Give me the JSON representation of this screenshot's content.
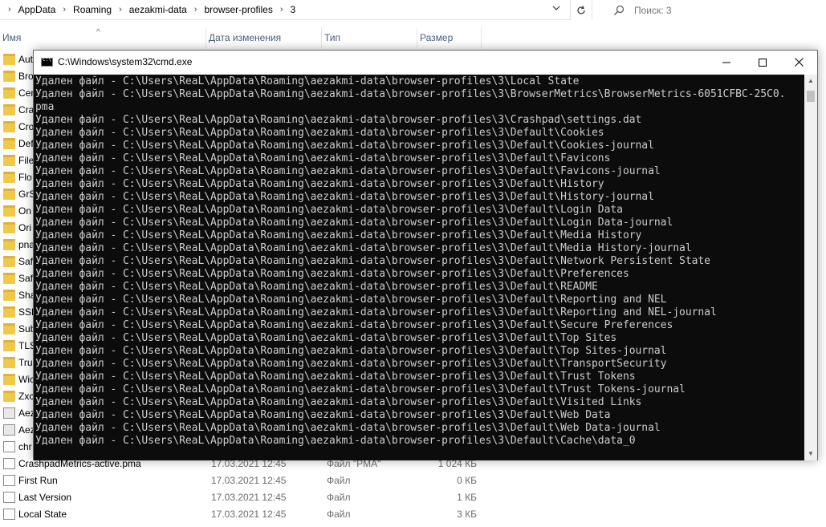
{
  "explorer": {
    "breadcrumb": [
      "AppData",
      "Roaming",
      "aezakmi-data",
      "browser-profiles",
      "3"
    ],
    "search_placeholder": "Поиск: 3",
    "columns": {
      "name": "Имя",
      "date": "Дата изменения",
      "type": "Тип",
      "size": "Размер"
    },
    "visible_rows": [
      {
        "name": "Aut",
        "icon": "folder-icon"
      },
      {
        "name": "Bro",
        "icon": "folder-icon"
      },
      {
        "name": "Cer",
        "icon": "folder-icon"
      },
      {
        "name": "Cras",
        "icon": "folder-icon"
      },
      {
        "name": "Cro",
        "icon": "folder-icon"
      },
      {
        "name": "Def",
        "icon": "folder-icon"
      },
      {
        "name": "File",
        "icon": "folder-icon"
      },
      {
        "name": "Flo",
        "icon": "folder-icon"
      },
      {
        "name": "GrS",
        "icon": "folder-icon"
      },
      {
        "name": "On",
        "icon": "folder-icon"
      },
      {
        "name": "Ori",
        "icon": "folder-icon"
      },
      {
        "name": "pna",
        "icon": "folder-icon"
      },
      {
        "name": "Saf",
        "icon": "folder-icon"
      },
      {
        "name": "Saf",
        "icon": "folder-icon"
      },
      {
        "name": "Sha",
        "icon": "folder-icon"
      },
      {
        "name": "SSL",
        "icon": "folder-icon"
      },
      {
        "name": "Sub",
        "icon": "folder-icon"
      },
      {
        "name": "TLS",
        "icon": "folder-icon"
      },
      {
        "name": "Tru",
        "icon": "folder-icon"
      },
      {
        "name": "Wic",
        "icon": "folder-icon"
      },
      {
        "name": "Zxc",
        "icon": "folder-icon"
      },
      {
        "name": "Aez",
        "icon": "app-icon"
      },
      {
        "name": "Aez",
        "icon": "app-icon"
      },
      {
        "name": "chr",
        "icon": "file-icon"
      },
      {
        "name": "CrashpadMetrics-active.pma",
        "date": "17.03.2021 12:45",
        "type": "Файл \"PMA\"",
        "size": "1 024 КБ",
        "icon": "file-icon"
      },
      {
        "name": "First Run",
        "date": "17.03.2021 12:45",
        "type": "Файл",
        "size": "0 КБ",
        "icon": "file-icon"
      },
      {
        "name": "Last Version",
        "date": "17.03.2021 12:45",
        "type": "Файл",
        "size": "1 КБ",
        "icon": "file-icon"
      },
      {
        "name": "Local State",
        "date": "17.03.2021 12:45",
        "type": "Файл",
        "size": "3 КБ",
        "icon": "file-icon"
      }
    ]
  },
  "cmd": {
    "title": "C:\\Windows\\system32\\cmd.exe",
    "lines": [
      "Удален файл - C:\\Users\\ReaL\\AppData\\Roaming\\aezakmi-data\\browser-profiles\\3\\Local State",
      "Удален файл - C:\\Users\\ReaL\\AppData\\Roaming\\aezakmi-data\\browser-profiles\\3\\BrowserMetrics\\BrowserMetrics-6051CFBC-25C0.",
      "pma",
      "Удален файл - C:\\Users\\ReaL\\AppData\\Roaming\\aezakmi-data\\browser-profiles\\3\\Crashpad\\settings.dat",
      "Удален файл - C:\\Users\\ReaL\\AppData\\Roaming\\aezakmi-data\\browser-profiles\\3\\Default\\Cookies",
      "Удален файл - C:\\Users\\ReaL\\AppData\\Roaming\\aezakmi-data\\browser-profiles\\3\\Default\\Cookies-journal",
      "Удален файл - C:\\Users\\ReaL\\AppData\\Roaming\\aezakmi-data\\browser-profiles\\3\\Default\\Favicons",
      "Удален файл - C:\\Users\\ReaL\\AppData\\Roaming\\aezakmi-data\\browser-profiles\\3\\Default\\Favicons-journal",
      "Удален файл - C:\\Users\\ReaL\\AppData\\Roaming\\aezakmi-data\\browser-profiles\\3\\Default\\History",
      "Удален файл - C:\\Users\\ReaL\\AppData\\Roaming\\aezakmi-data\\browser-profiles\\3\\Default\\History-journal",
      "Удален файл - C:\\Users\\ReaL\\AppData\\Roaming\\aezakmi-data\\browser-profiles\\3\\Default\\Login Data",
      "Удален файл - C:\\Users\\ReaL\\AppData\\Roaming\\aezakmi-data\\browser-profiles\\3\\Default\\Login Data-journal",
      "Удален файл - C:\\Users\\ReaL\\AppData\\Roaming\\aezakmi-data\\browser-profiles\\3\\Default\\Media History",
      "Удален файл - C:\\Users\\ReaL\\AppData\\Roaming\\aezakmi-data\\browser-profiles\\3\\Default\\Media History-journal",
      "Удален файл - C:\\Users\\ReaL\\AppData\\Roaming\\aezakmi-data\\browser-profiles\\3\\Default\\Network Persistent State",
      "Удален файл - C:\\Users\\ReaL\\AppData\\Roaming\\aezakmi-data\\browser-profiles\\3\\Default\\Preferences",
      "Удален файл - C:\\Users\\ReaL\\AppData\\Roaming\\aezakmi-data\\browser-profiles\\3\\Default\\README",
      "Удален файл - C:\\Users\\ReaL\\AppData\\Roaming\\aezakmi-data\\browser-profiles\\3\\Default\\Reporting and NEL",
      "Удален файл - C:\\Users\\ReaL\\AppData\\Roaming\\aezakmi-data\\browser-profiles\\3\\Default\\Reporting and NEL-journal",
      "Удален файл - C:\\Users\\ReaL\\AppData\\Roaming\\aezakmi-data\\browser-profiles\\3\\Default\\Secure Preferences",
      "Удален файл - C:\\Users\\ReaL\\AppData\\Roaming\\aezakmi-data\\browser-profiles\\3\\Default\\Top Sites",
      "Удален файл - C:\\Users\\ReaL\\AppData\\Roaming\\aezakmi-data\\browser-profiles\\3\\Default\\Top Sites-journal",
      "Удален файл - C:\\Users\\ReaL\\AppData\\Roaming\\aezakmi-data\\browser-profiles\\3\\Default\\TransportSecurity",
      "Удален файл - C:\\Users\\ReaL\\AppData\\Roaming\\aezakmi-data\\browser-profiles\\3\\Default\\Trust Tokens",
      "Удален файл - C:\\Users\\ReaL\\AppData\\Roaming\\aezakmi-data\\browser-profiles\\3\\Default\\Trust Tokens-journal",
      "Удален файл - C:\\Users\\ReaL\\AppData\\Roaming\\aezakmi-data\\browser-profiles\\3\\Default\\Visited Links",
      "Удален файл - C:\\Users\\ReaL\\AppData\\Roaming\\aezakmi-data\\browser-profiles\\3\\Default\\Web Data",
      "Удален файл - C:\\Users\\ReaL\\AppData\\Roaming\\aezakmi-data\\browser-profiles\\3\\Default\\Web Data-journal",
      "Удален файл - C:\\Users\\ReaL\\AppData\\Roaming\\aezakmi-data\\browser-profiles\\3\\Default\\Cache\\data_0"
    ]
  },
  "colors": {
    "console_bg": "#0c0c0c",
    "console_text": "#cccccc",
    "folder": "#f0c94a",
    "header_text": "#4c607a"
  }
}
